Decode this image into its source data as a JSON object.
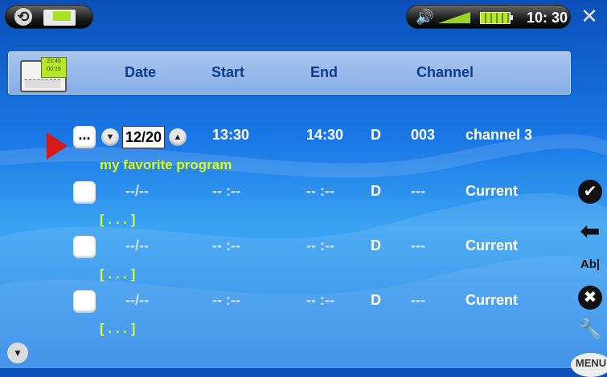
{
  "status": {
    "time": "10: 30"
  },
  "header": {
    "columns": {
      "date": "Date",
      "start": "Start",
      "end": "End",
      "channel": "Channel"
    }
  },
  "rows": [
    {
      "marker": "...",
      "date": "12/20",
      "start": "13:30",
      "end": "14:30",
      "mode": "D",
      "channel_no": "003",
      "channel": "channel 3",
      "name": "my favorite program"
    },
    {
      "date": "--/--",
      "start": "-- :--",
      "end": "-- :--",
      "mode": "D",
      "channel_no": "---",
      "channel": "Current",
      "name": "[ . . . ]"
    },
    {
      "date": "--/--",
      "start": "-- :--",
      "end": "-- :--",
      "mode": "D",
      "channel_no": "---",
      "channel": "Current",
      "name": "[ . . . ]"
    },
    {
      "date": "--/--",
      "start": "-- :--",
      "end": "-- :--",
      "mode": "D",
      "channel_no": "---",
      "channel": "Current",
      "name": "[ . . . ]"
    }
  ],
  "sidebar": {
    "menu_label": "MENU",
    "text_edit_label": "Ab|"
  },
  "icons": [
    "refresh-icon",
    "device-icon",
    "speaker-icon",
    "volume-icon",
    "battery-icon",
    "close-icon",
    "calendar-icon",
    "confirm-icon",
    "back-icon",
    "text-edit-icon",
    "cancel-icon",
    "settings-icon",
    "scroll-down-icon"
  ],
  "colors": {
    "accent_green": "#d8ff1e",
    "pointer_red": "#d51a1a",
    "header_text": "#0b3b8a"
  }
}
